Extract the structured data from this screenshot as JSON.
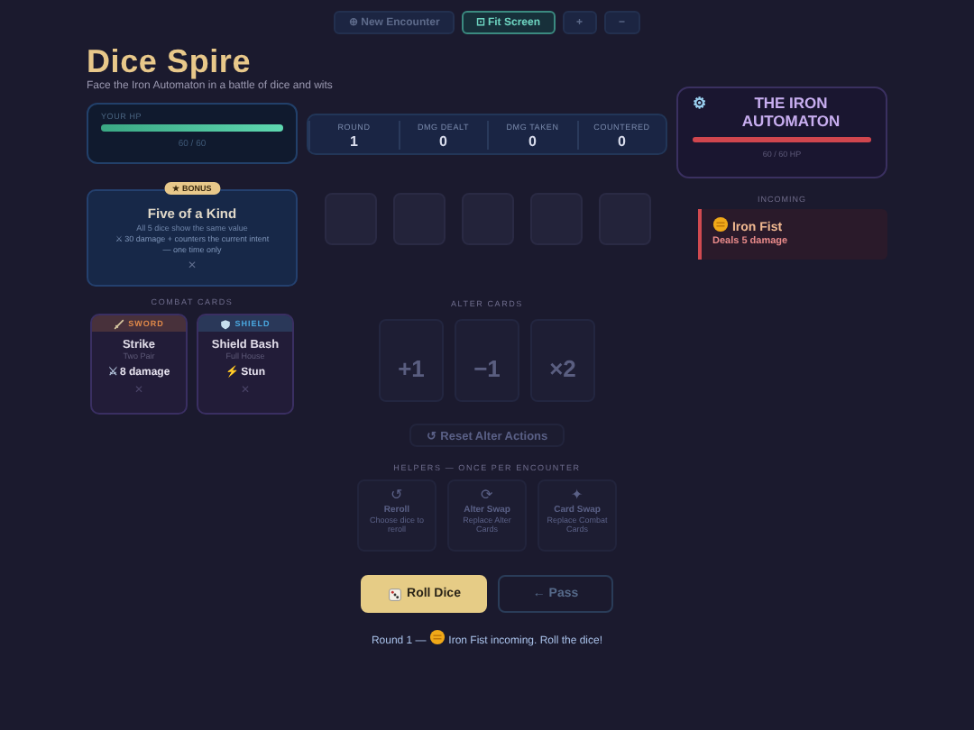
{
  "toolbar": [
    {
      "label": "⊕ New Encounter",
      "active": false
    },
    {
      "label": "⊡ Fit Screen",
      "active": true
    },
    {
      "label": "+",
      "active": false
    },
    {
      "label": "−",
      "active": false
    }
  ],
  "title": "Dice Spire",
  "subtitle": "Face the Iron Automaton in a battle of dice and wits",
  "player": {
    "label": "YOUR HP",
    "level": 1,
    "reading": "60 / 60"
  },
  "stats": [
    {
      "label": "ROUND",
      "value": "1"
    },
    {
      "label": "DMG DEALT",
      "value": "0"
    },
    {
      "label": "DMG TAKEN",
      "value": "0"
    },
    {
      "label": "COUNTERED",
      "value": "0"
    }
  ],
  "enemy": {
    "icon": "⚙",
    "name": "THE IRON AUTOMATON",
    "level": 1,
    "reading": "60 / 60 HP"
  },
  "incoming": {
    "label": "INCOMING",
    "name": "Iron Fist",
    "detail": "Deals 5 damage"
  },
  "bonus": {
    "badge": "★ BONUS",
    "title": "Five of a Kind",
    "description": "All 5 dice show the same value",
    "effect": "⚔ 30 damage + counters the current intent — one time only",
    "remove": "✕"
  },
  "dice": [
    {
      "empty": true
    },
    {
      "empty": true
    },
    {
      "empty": true
    },
    {
      "empty": true
    },
    {
      "empty": true
    }
  ],
  "combat_label": "COMBAT CARDS",
  "combat_cards": [
    {
      "kind": "sword",
      "tag": "SWORD",
      "color": "#e0894a",
      "name": "Strike",
      "hand": "Two Pair",
      "effect_icon": "⚔",
      "effect": "8 damage",
      "remove": "✕"
    },
    {
      "kind": "shield",
      "tag": "SHIELD",
      "color": "#4aa8e0",
      "name": "Shield Bash",
      "hand": "Full House",
      "effect_icon": "⚡",
      "effect": "Stun",
      "remove": "✕"
    }
  ],
  "alter_label": "ALTER CARDS",
  "alter_cards": [
    {
      "symbol": "+1",
      "disabled": true
    },
    {
      "symbol": "−1",
      "disabled": true
    },
    {
      "symbol": "×2",
      "disabled": true
    }
  ],
  "reset": {
    "label": "↺ Reset Alter Actions",
    "disabled": true
  },
  "helpers_label": "HELPERS — ONCE PER ENCOUNTER",
  "helpers": [
    {
      "icon": "↺",
      "name": "Reroll",
      "description": "Choose dice to reroll",
      "disabled": true
    },
    {
      "icon": "⟳",
      "name": "Alter Swap",
      "description": "Replace Alter Cards",
      "disabled": true
    },
    {
      "icon": "✦",
      "name": "Card Swap",
      "description": "Replace Combat Cards",
      "disabled": true
    }
  ],
  "roll_button": {
    "label": "Roll Dice",
    "disabled": false
  },
  "pass_button": {
    "label": "← Pass",
    "disabled": true
  },
  "status": {
    "before": "Round 1 —",
    "after": "Iron Fist incoming. Roll the dice!"
  }
}
